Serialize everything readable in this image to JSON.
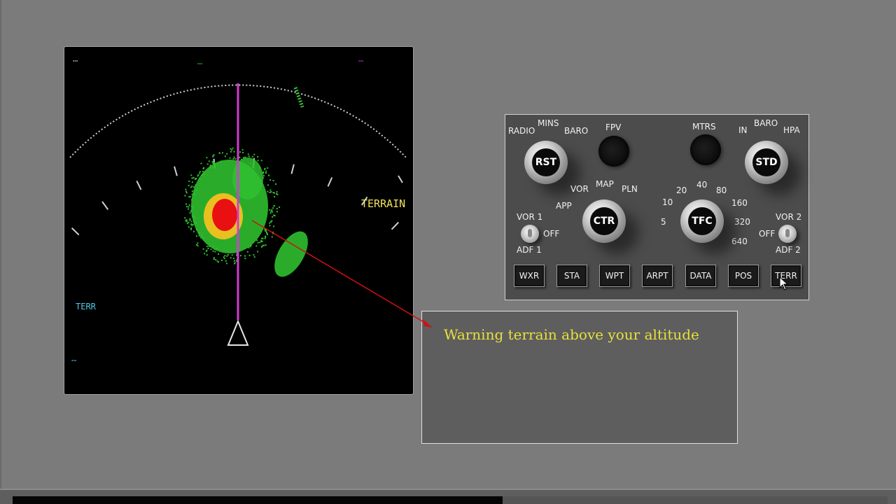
{
  "nd": {
    "terrain_label": "TERRAIN",
    "terr_mode_label": "TERR",
    "unreadable_top_left": "…",
    "unreadable_top_center": "…",
    "unreadable_top_right": "…",
    "unreadable_bottom_left": "…"
  },
  "panel": {
    "labels": {
      "radio": "RADIO",
      "mins": "MINS",
      "baro_left": "BARO",
      "fpv": "FPV",
      "mtrs": "MTRS",
      "in": "IN",
      "baro_right": "BARO",
      "hpa": "HPA",
      "vor": "VOR",
      "map": "MAP",
      "pln": "PLN",
      "app": "APP",
      "vor1": "VOR 1",
      "off_left": "OFF",
      "adf1": "ADF 1",
      "vor2": "VOR 2",
      "off_right": "OFF",
      "adf2": "ADF 2"
    },
    "knobs": {
      "rst": "RST",
      "ctr": "CTR",
      "tfc": "TFC",
      "std": "STD"
    },
    "ranges": [
      "5",
      "10",
      "20",
      "40",
      "80",
      "160",
      "320",
      "640"
    ],
    "buttons": [
      "WXR",
      "STA",
      "WPT",
      "ARPT",
      "DATA",
      "POS",
      "TERR"
    ]
  },
  "message": {
    "text": "Warning terrain above your altitude"
  },
  "colors": {
    "terrain_green": "#2fbf2f",
    "terrain_yellow": "#e8c020",
    "terrain_red": "#e81010",
    "track_magenta": "#d23cd2",
    "warning_text": "#e8e03c",
    "arrow_red": "#d01010"
  },
  "progress": {
    "fraction": 0.56
  }
}
